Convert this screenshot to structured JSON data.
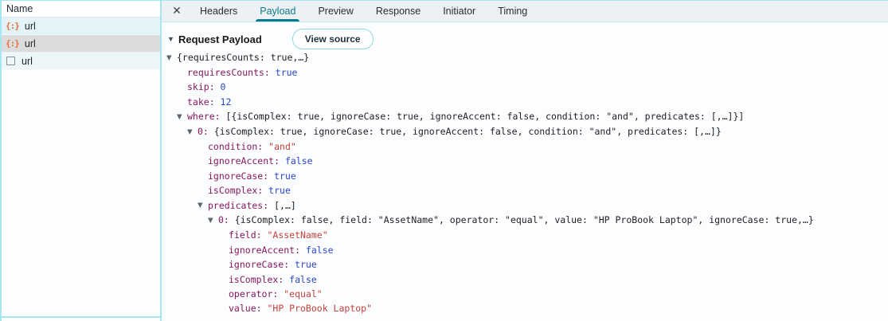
{
  "colors": {
    "accent": "#0d7a8c",
    "key": "#86185d",
    "str": "#c5413a",
    "lit": "#2b46c8",
    "preview": "#202124",
    "frame": "#a5e6f0",
    "sel": "#dcdcdc",
    "stripe1": "#e4f3f8",
    "stripe3": "#edf7fa",
    "icon_orange": "#e8703a",
    "tabbar_bg": "#edf1f3"
  },
  "sidebar": {
    "header": "Name",
    "rows": [
      {
        "icon": "json-braces-icon",
        "label": "url",
        "selected": false
      },
      {
        "icon": "json-braces-icon",
        "label": "url",
        "selected": true
      },
      {
        "icon": "document-square-icon",
        "label": "url",
        "selected": false
      }
    ]
  },
  "tabs": {
    "close_label": "✕",
    "items": [
      {
        "label": "Headers",
        "active": false
      },
      {
        "label": "Payload",
        "active": true
      },
      {
        "label": "Preview",
        "active": false
      },
      {
        "label": "Response",
        "active": false
      },
      {
        "label": "Initiator",
        "active": false
      },
      {
        "label": "Timing",
        "active": false
      }
    ]
  },
  "payload": {
    "section_title": "Request Payload",
    "view_source_label": "View source",
    "expand_triangle": "▼",
    "tree_rows": [
      {
        "level": 0,
        "expandable": true,
        "key": null,
        "value": "{requiresCounts: true,…}",
        "type": "preview"
      },
      {
        "level": 1,
        "expandable": false,
        "key": "requiresCounts",
        "value": "true",
        "type": "bool"
      },
      {
        "level": 1,
        "expandable": false,
        "key": "skip",
        "value": "0",
        "type": "num"
      },
      {
        "level": 1,
        "expandable": false,
        "key": "take",
        "value": "12",
        "type": "num"
      },
      {
        "level": 1,
        "expandable": true,
        "key": "where",
        "value": "[{isComplex: true, ignoreCase: true, ignoreAccent: false, condition: \"and\", predicates: [,…]}]",
        "type": "preview"
      },
      {
        "level": 2,
        "expandable": true,
        "key": "0",
        "value": "{isComplex: true, ignoreCase: true, ignoreAccent: false, condition: \"and\", predicates: [,…]}",
        "type": "preview"
      },
      {
        "level": 3,
        "expandable": false,
        "key": "condition",
        "value": "\"and\"",
        "type": "str"
      },
      {
        "level": 3,
        "expandable": false,
        "key": "ignoreAccent",
        "value": "false",
        "type": "bool"
      },
      {
        "level": 3,
        "expandable": false,
        "key": "ignoreCase",
        "value": "true",
        "type": "bool"
      },
      {
        "level": 3,
        "expandable": false,
        "key": "isComplex",
        "value": "true",
        "type": "bool"
      },
      {
        "level": 3,
        "expandable": true,
        "key": "predicates",
        "value": "[,…]",
        "type": "preview"
      },
      {
        "level": 4,
        "expandable": true,
        "key": "0",
        "value": "{isComplex: false, field: \"AssetName\", operator: \"equal\", value: \"HP ProBook Laptop\", ignoreCase: true,…}",
        "type": "preview"
      },
      {
        "level": 5,
        "expandable": false,
        "key": "field",
        "value": "\"AssetName\"",
        "type": "str"
      },
      {
        "level": 5,
        "expandable": false,
        "key": "ignoreAccent",
        "value": "false",
        "type": "bool"
      },
      {
        "level": 5,
        "expandable": false,
        "key": "ignoreCase",
        "value": "true",
        "type": "bool"
      },
      {
        "level": 5,
        "expandable": false,
        "key": "isComplex",
        "value": "false",
        "type": "bool"
      },
      {
        "level": 5,
        "expandable": false,
        "key": "operator",
        "value": "\"equal\"",
        "type": "str"
      },
      {
        "level": 5,
        "expandable": false,
        "key": "value",
        "value": "\"HP ProBook Laptop\"",
        "type": "str"
      }
    ]
  }
}
